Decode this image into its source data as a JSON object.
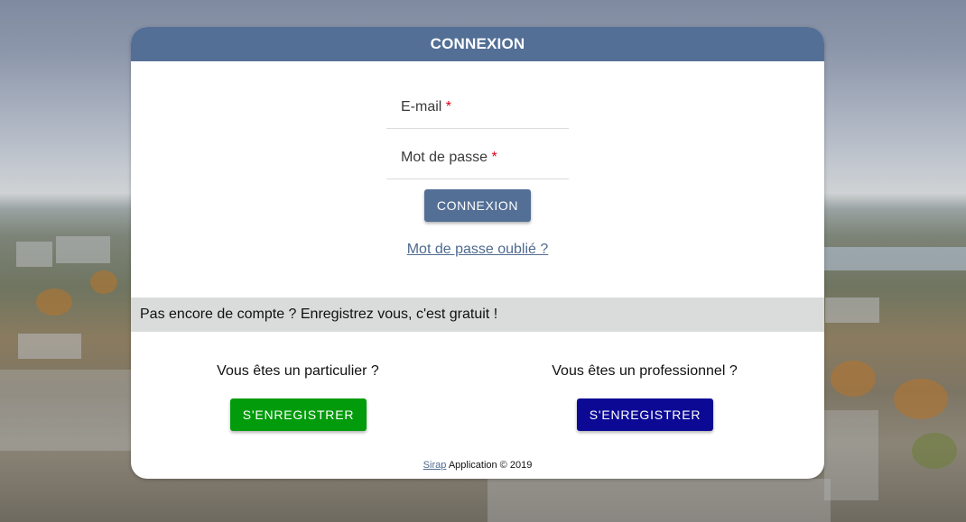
{
  "header": {
    "title": "CONNEXION"
  },
  "login": {
    "email_label": "E-mail",
    "password_label": "Mot de passe",
    "required_mark": "*",
    "submit_label": "CONNEXION",
    "forgot_label": "Mot de passe oublié ?"
  },
  "signup": {
    "banner": "Pas encore de compte ? Enregistrez vous, c'est gratuit !",
    "individual": {
      "question": "Vous êtes un particulier ?",
      "button": "S'ENREGISTRER"
    },
    "professional": {
      "question": "Vous êtes un professionnel ?",
      "button": "S'ENREGISTRER"
    }
  },
  "footer": {
    "link": "Sirap",
    "text": "Application © 2019"
  },
  "colors": {
    "primary": "#536f96",
    "individual_button": "#029b0c",
    "professional_button": "#0c0a95",
    "required": "#e0001a",
    "banner": "#dadcdb"
  }
}
